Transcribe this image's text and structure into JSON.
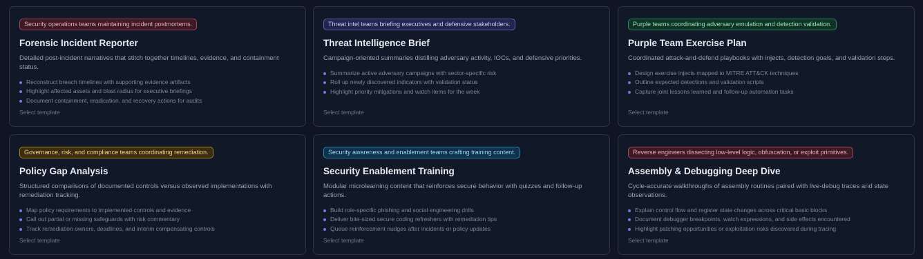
{
  "templates": [
    {
      "badge": "Security operations teams maintaining incident postmortems.",
      "badge_color": "#a34a5c",
      "title": "Forensic Incident Reporter",
      "description": "Detailed post-incident narratives that stitch together timelines, evidence, and containment status.",
      "bullets": [
        "Reconstruct breach timelines with supporting evidence artifacts",
        "Highlight affected assets and blast radius for executive briefings",
        "Document containment, eradication, and recovery actions for audits"
      ],
      "action": "Select template"
    },
    {
      "badge": "Threat intel teams briefing executives and defensive stakeholders.",
      "badge_color": "#5b62b8",
      "title": "Threat Intelligence Brief",
      "description": "Campaign-oriented summaries distilling adversary activity, IOCs, and defensive priorities.",
      "bullets": [
        "Summarize active adversary campaigns with sector-specific risk",
        "Roll up newly discovered indicators with validation status",
        "Highlight priority mitigations and watch items for the week"
      ],
      "action": "Select template"
    },
    {
      "badge": "Purple teams coordinating adversary emulation and detection validation.",
      "badge_color": "#2f8a62",
      "title": "Purple Team Exercise Plan",
      "description": "Coordinated attack-and-defend playbooks with injects, detection goals, and validation steps.",
      "bullets": [
        "Design exercise injects mapped to MITRE ATT&CK techniques",
        "Outline expected detections and validation scripts",
        "Capture joint lessons learned and follow-up automation tasks"
      ],
      "action": "Select template"
    },
    {
      "badge": "Governance, risk, and compliance teams coordinating remediation.",
      "badge_color": "#a8822d",
      "title": "Policy Gap Analysis",
      "description": "Structured comparisons of documented controls versus observed implementations with remediation tracking.",
      "bullets": [
        "Map policy requirements to implemented controls and evidence",
        "Call out partial or missing safeguards with risk commentary",
        "Track remediation owners, deadlines, and interim compensating controls"
      ],
      "action": "Select template"
    },
    {
      "badge": "Security awareness and enablement teams crafting training content.",
      "badge_color": "#2e86b3",
      "title": "Security Enablement Training",
      "description": "Modular microlearning content that reinforces secure behavior with quizzes and follow-up actions.",
      "bullets": [
        "Build role-specific phishing and social engineering drills",
        "Deliver bite-sized secure coding refreshers with remediation tips",
        "Queue reinforcement nudges after incidents or policy updates"
      ],
      "action": "Select template"
    },
    {
      "badge": "Reverse engineers dissecting low-level logic, obfuscation, or exploit primitives.",
      "badge_color": "#a34a5c",
      "title": "Assembly & Debugging Deep Dive",
      "description": "Cycle-accurate walkthroughs of assembly routines paired with live-debug traces and state observations.",
      "bullets": [
        "Explain control flow and register state changes across critical basic blocks",
        "Document debugger breakpoints, watch expressions, and side effects encountered",
        "Highlight patching opportunities or exploitation risks discovered during tracing"
      ],
      "action": "Select template"
    }
  ],
  "bullet_color": "#6e7be0"
}
